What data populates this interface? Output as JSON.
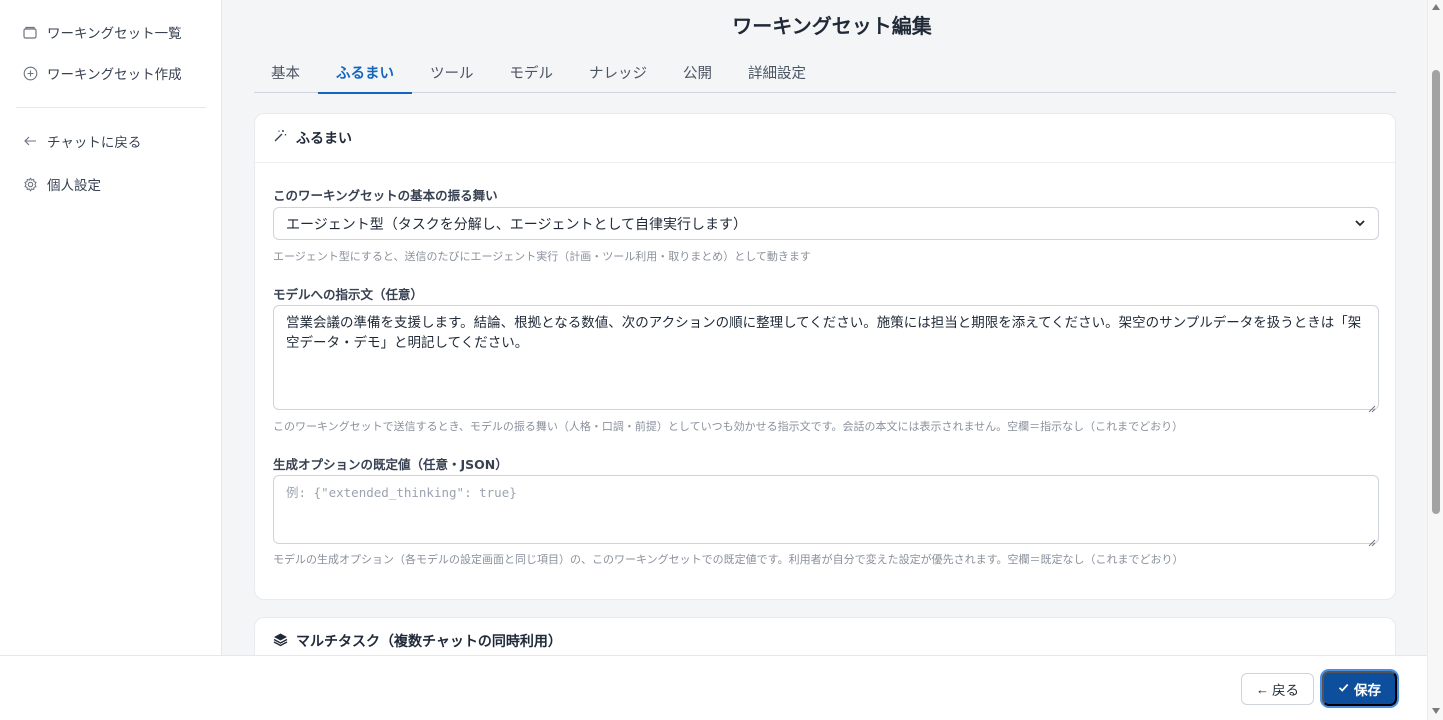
{
  "sidebar": {
    "items": [
      {
        "label": "ワーキングセット一覧",
        "icon": "folder-icon"
      },
      {
        "label": "ワーキングセット作成",
        "icon": "plus-circle-icon"
      },
      {
        "label": "チャットに戻る",
        "icon": "arrow-left-icon"
      },
      {
        "label": "個人設定",
        "icon": "gear-icon"
      }
    ]
  },
  "page": {
    "title": "ワーキングセット編集"
  },
  "tabs": [
    {
      "label": "基本"
    },
    {
      "label": "ふるまい",
      "active": true
    },
    {
      "label": "ツール"
    },
    {
      "label": "モデル"
    },
    {
      "label": "ナレッジ"
    },
    {
      "label": "公開"
    },
    {
      "label": "詳細設定"
    }
  ],
  "behavior_card": {
    "title": "ふるまい",
    "icon": "magic-wand-icon",
    "mode": {
      "label": "このワーキングセットの基本の振る舞い",
      "value": "エージェント型（タスクを分解し、エージェントとして自律実行します）",
      "help": "エージェント型にすると、送信のたびにエージェント実行（計画・ツール利用・取りまとめ）として動きます"
    },
    "instruction": {
      "label": "モデルへの指示文（任意）",
      "value": "営業会議の準備を支援します。結論、根拠となる数値、次のアクションの順に整理してください。施策には担当と期限を添えてください。架空のサンプルデータを扱うときは「架空データ・デモ」と明記してください。",
      "help": "このワーキングセットで送信するとき、モデルの振る舞い（人格・口調・前提）としていつも効かせる指示文です。会話の本文には表示されません。空欄＝指示なし（これまでどおり）"
    },
    "gen_options": {
      "label": "生成オプションの既定値（任意・JSON）",
      "placeholder": "例: {\"extended_thinking\": true}",
      "help": "モデルの生成オプション（各モデルの設定画面と同じ項目）の、このワーキングセットでの既定値です。利用者が自分で変えた設定が優先されます。空欄＝既定なし（これまでどおり）"
    }
  },
  "multitask_card": {
    "title": "マルチタスク（複数チャットの同時利用）",
    "icon": "layers-icon"
  },
  "footer": {
    "back_label": "戻る",
    "save_label": "保存"
  },
  "colors": {
    "accent": "#1565c0",
    "save_button": "#0d4f9c"
  }
}
